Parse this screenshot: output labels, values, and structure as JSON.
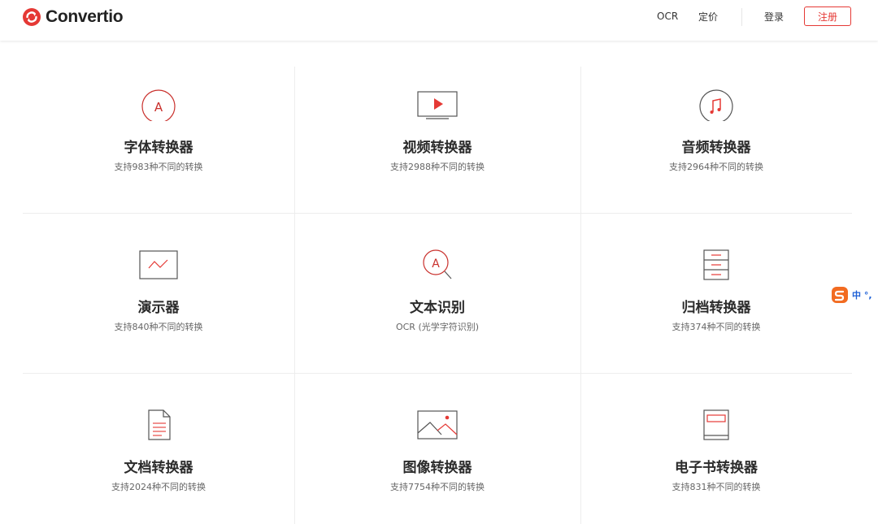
{
  "header": {
    "brand": "Convertio",
    "nav": {
      "ocr": "OCR",
      "pricing": "定价",
      "login": "登录",
      "signup": "注册"
    }
  },
  "tools": [
    {
      "title": "字体转换器",
      "subtitle": "支持983种不同的转换",
      "icon": "font-icon"
    },
    {
      "title": "视频转换器",
      "subtitle": "支持2988种不同的转换",
      "icon": "video-play-icon"
    },
    {
      "title": "音频转换器",
      "subtitle": "支持2964种不同的转换",
      "icon": "music-note-icon"
    },
    {
      "title": "演示器",
      "subtitle": "支持840种不同的转换",
      "icon": "presentation-chart-icon"
    },
    {
      "title": "文本识别",
      "subtitle": "OCR (光学字符识别)",
      "icon": "ocr-magnifier-icon"
    },
    {
      "title": "归档转换器",
      "subtitle": "支持374种不同的转换",
      "icon": "archive-drawers-icon"
    },
    {
      "title": "文档转换器",
      "subtitle": "支持2024种不同的转换",
      "icon": "document-icon"
    },
    {
      "title": "图像转换器",
      "subtitle": "支持7754种不同的转换",
      "icon": "image-icon"
    },
    {
      "title": "电子书转换器",
      "subtitle": "支持831种不同的转换",
      "icon": "ebook-icon"
    }
  ],
  "ime_widget": {
    "label": "中 °,"
  },
  "colors": {
    "accent": "#e53935",
    "text": "#2b2b2b",
    "muted": "#666666",
    "divider": "#ededed"
  }
}
